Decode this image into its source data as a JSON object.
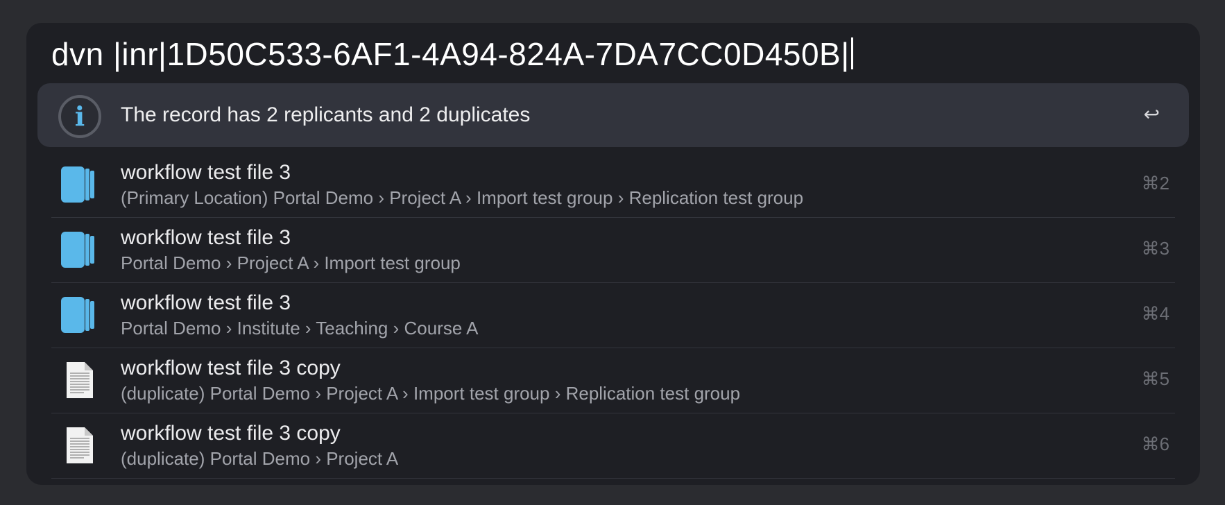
{
  "query": {
    "text": "dvn |inr|1D50C533-6AF1-4A94-824A-7DA7CC0D450B|"
  },
  "selected": {
    "icon": "info-icon",
    "glyph": "i",
    "text": "The record has 2 replicants and 2 duplicates",
    "return_icon": "return-icon",
    "return_glyph": "↩"
  },
  "results": [
    {
      "icon": "replicant-file-icon",
      "title": "workflow test file 3",
      "path": "(Primary Location) Portal Demo › Project A › Import test group › Replication test group",
      "shortcut": "⌘2"
    },
    {
      "icon": "replicant-file-icon",
      "title": "workflow test file 3",
      "path": "Portal Demo › Project A › Import test group",
      "shortcut": "⌘3"
    },
    {
      "icon": "replicant-file-icon",
      "title": "workflow test file 3",
      "path": "Portal Demo › Institute › Teaching › Course A",
      "shortcut": "⌘4"
    },
    {
      "icon": "document-icon",
      "title": "workflow test file 3 copy",
      "path": "(duplicate) Portal Demo › Project A › Import test group › Replication test group",
      "shortcut": "⌘5"
    },
    {
      "icon": "document-icon",
      "title": "workflow test file 3 copy",
      "path": "(duplicate) Portal Demo › Project A",
      "shortcut": "⌘6"
    }
  ],
  "colors": {
    "background": "#2b2c30",
    "panel": "#1e1f24",
    "selected_row": "#32343d",
    "accent_blue": "#5ab8ea"
  }
}
